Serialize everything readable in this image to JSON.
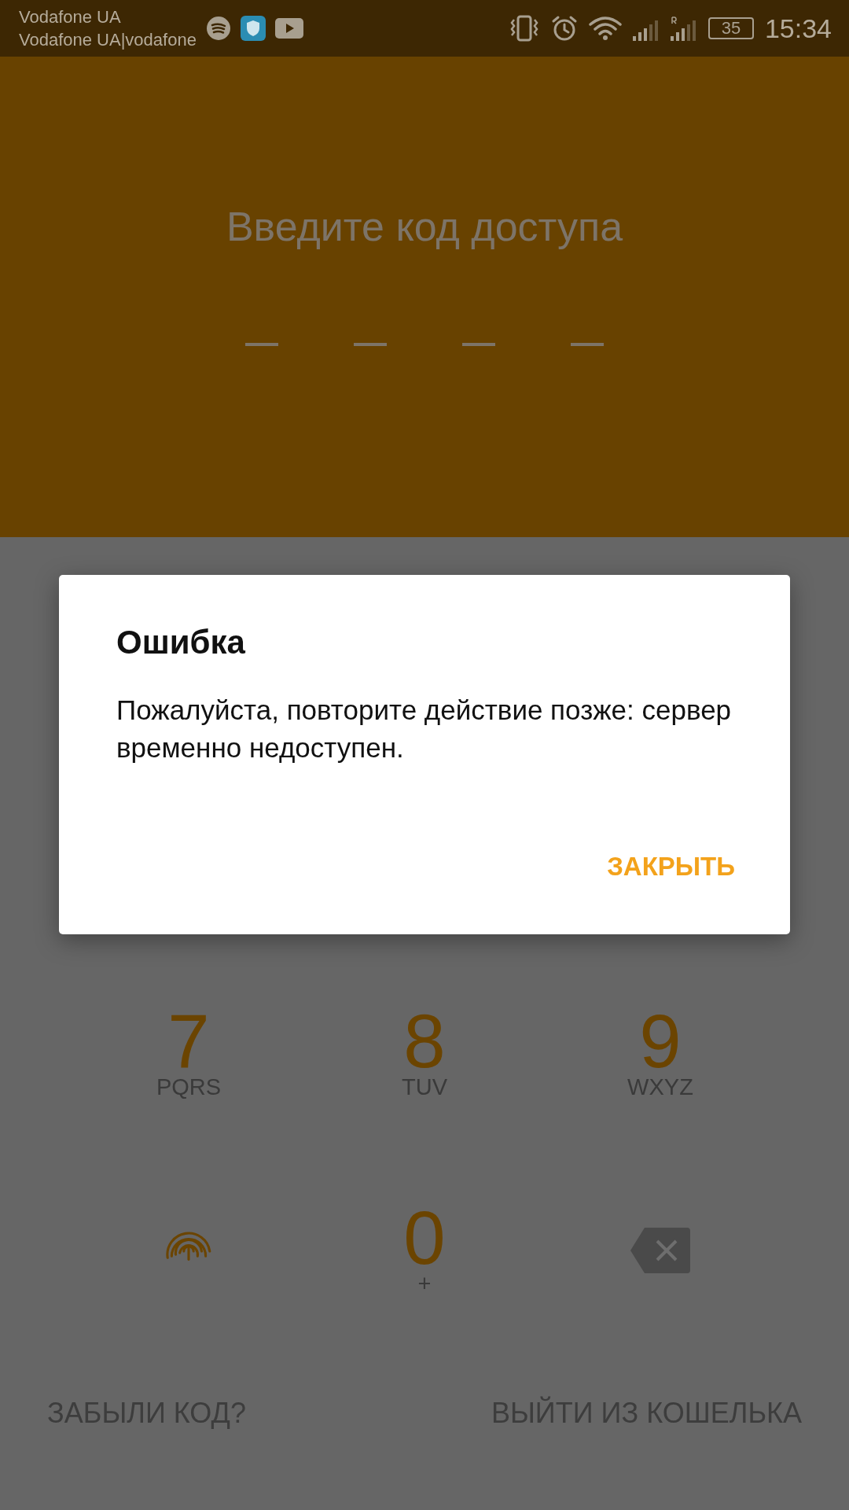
{
  "status_bar": {
    "carrier": "Vodafone UA",
    "carrier_detail": "Vodafone UA|vodafone",
    "battery": "35",
    "time": "15:34"
  },
  "header": {
    "title": "Введите код доступа",
    "pin_slots": [
      {
        "filled": false
      },
      {
        "filled": false
      },
      {
        "filled": false
      },
      {
        "filled": false
      }
    ]
  },
  "keypad": [
    {
      "kind": "digit",
      "digit": "7",
      "letters": "PQRS"
    },
    {
      "kind": "digit",
      "digit": "8",
      "letters": "TUV"
    },
    {
      "kind": "digit",
      "digit": "9",
      "letters": "WXYZ"
    },
    {
      "kind": "fingerprint"
    },
    {
      "kind": "digit",
      "digit": "0",
      "letters": "+"
    },
    {
      "kind": "backspace"
    }
  ],
  "footer": {
    "forgot": "ЗАБЫЛИ КОД?",
    "exit": "ВЫЙТИ ИЗ КОШЕЛЬКА"
  },
  "dialog": {
    "title": "Ошибка",
    "message": "Пожалуйста, повторите действие позже: сервер временно недоступен.",
    "button": "ЗАКРЫТЬ"
  }
}
